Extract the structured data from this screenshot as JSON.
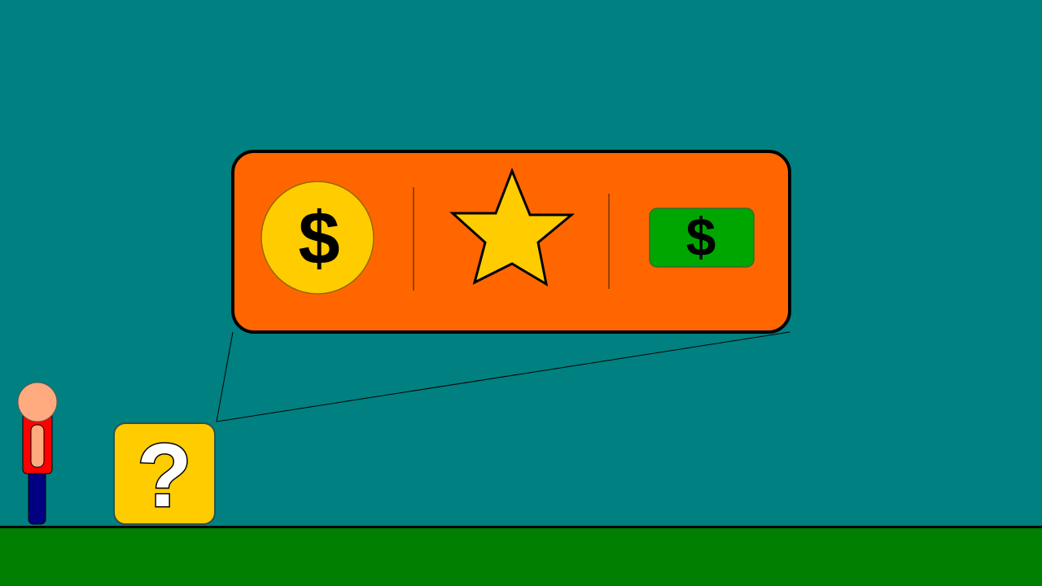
{
  "colors": {
    "sky": "#008080",
    "ground": "#007f00",
    "panel": "#ff6600",
    "panel_border": "#000000",
    "coin": "#ffcc00",
    "coin_border": "#996600",
    "star": "#ffcc00",
    "bill": "#00a600",
    "bill_border": "#2f6f2f",
    "block": "#ffcc00",
    "player_head": "#ffaa7f",
    "player_shirt": "#ff0000",
    "player_legs": "#000080"
  },
  "player": {
    "icon": "player-character"
  },
  "mystery_block": {
    "icon": "question-block-icon",
    "symbol": "?"
  },
  "reward_panel": {
    "rewards": [
      {
        "icon": "coin-icon",
        "symbol": "$"
      },
      {
        "icon": "star-icon"
      },
      {
        "icon": "dollar-bill-icon",
        "symbol": "$"
      }
    ]
  }
}
